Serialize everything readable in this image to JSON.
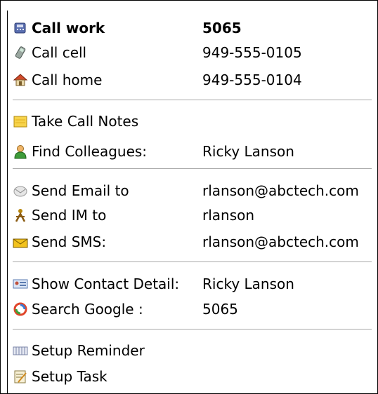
{
  "menu": {
    "call_work": {
      "label": "Call work",
      "value": "5065",
      "icon": "desk-phone-icon"
    },
    "call_cell": {
      "label": "Call cell",
      "value": "949-555-0105",
      "icon": "mobile-phone-icon"
    },
    "call_home": {
      "label": "Call home",
      "value": "949-555-0104",
      "icon": "house-icon"
    },
    "take_notes": {
      "label": "Take Call Notes",
      "icon": "notepad-icon"
    },
    "find_colleagues": {
      "label": "Find Colleagues:",
      "value": "Ricky Lanson",
      "icon": "person-icon"
    },
    "send_email": {
      "label": "Send Email to",
      "value": "rlanson@abctech.com",
      "icon": "email-icon"
    },
    "send_im": {
      "label": "Send IM to",
      "value": "rlanson",
      "icon": "im-buddy-icon"
    },
    "send_sms": {
      "label": "Send SMS:",
      "value": "rlanson@abctech.com",
      "icon": "envelope-icon"
    },
    "show_contact": {
      "label": "Show Contact Detail:",
      "value": "Ricky Lanson",
      "icon": "contact-card-icon"
    },
    "search_google": {
      "label": "Search Google :",
      "value": "5065",
      "icon": "google-swirl-icon"
    },
    "setup_reminder": {
      "label": "Setup Reminder",
      "icon": "calendar-icon"
    },
    "setup_task": {
      "label": "Setup Task",
      "icon": "task-pad-icon"
    }
  }
}
